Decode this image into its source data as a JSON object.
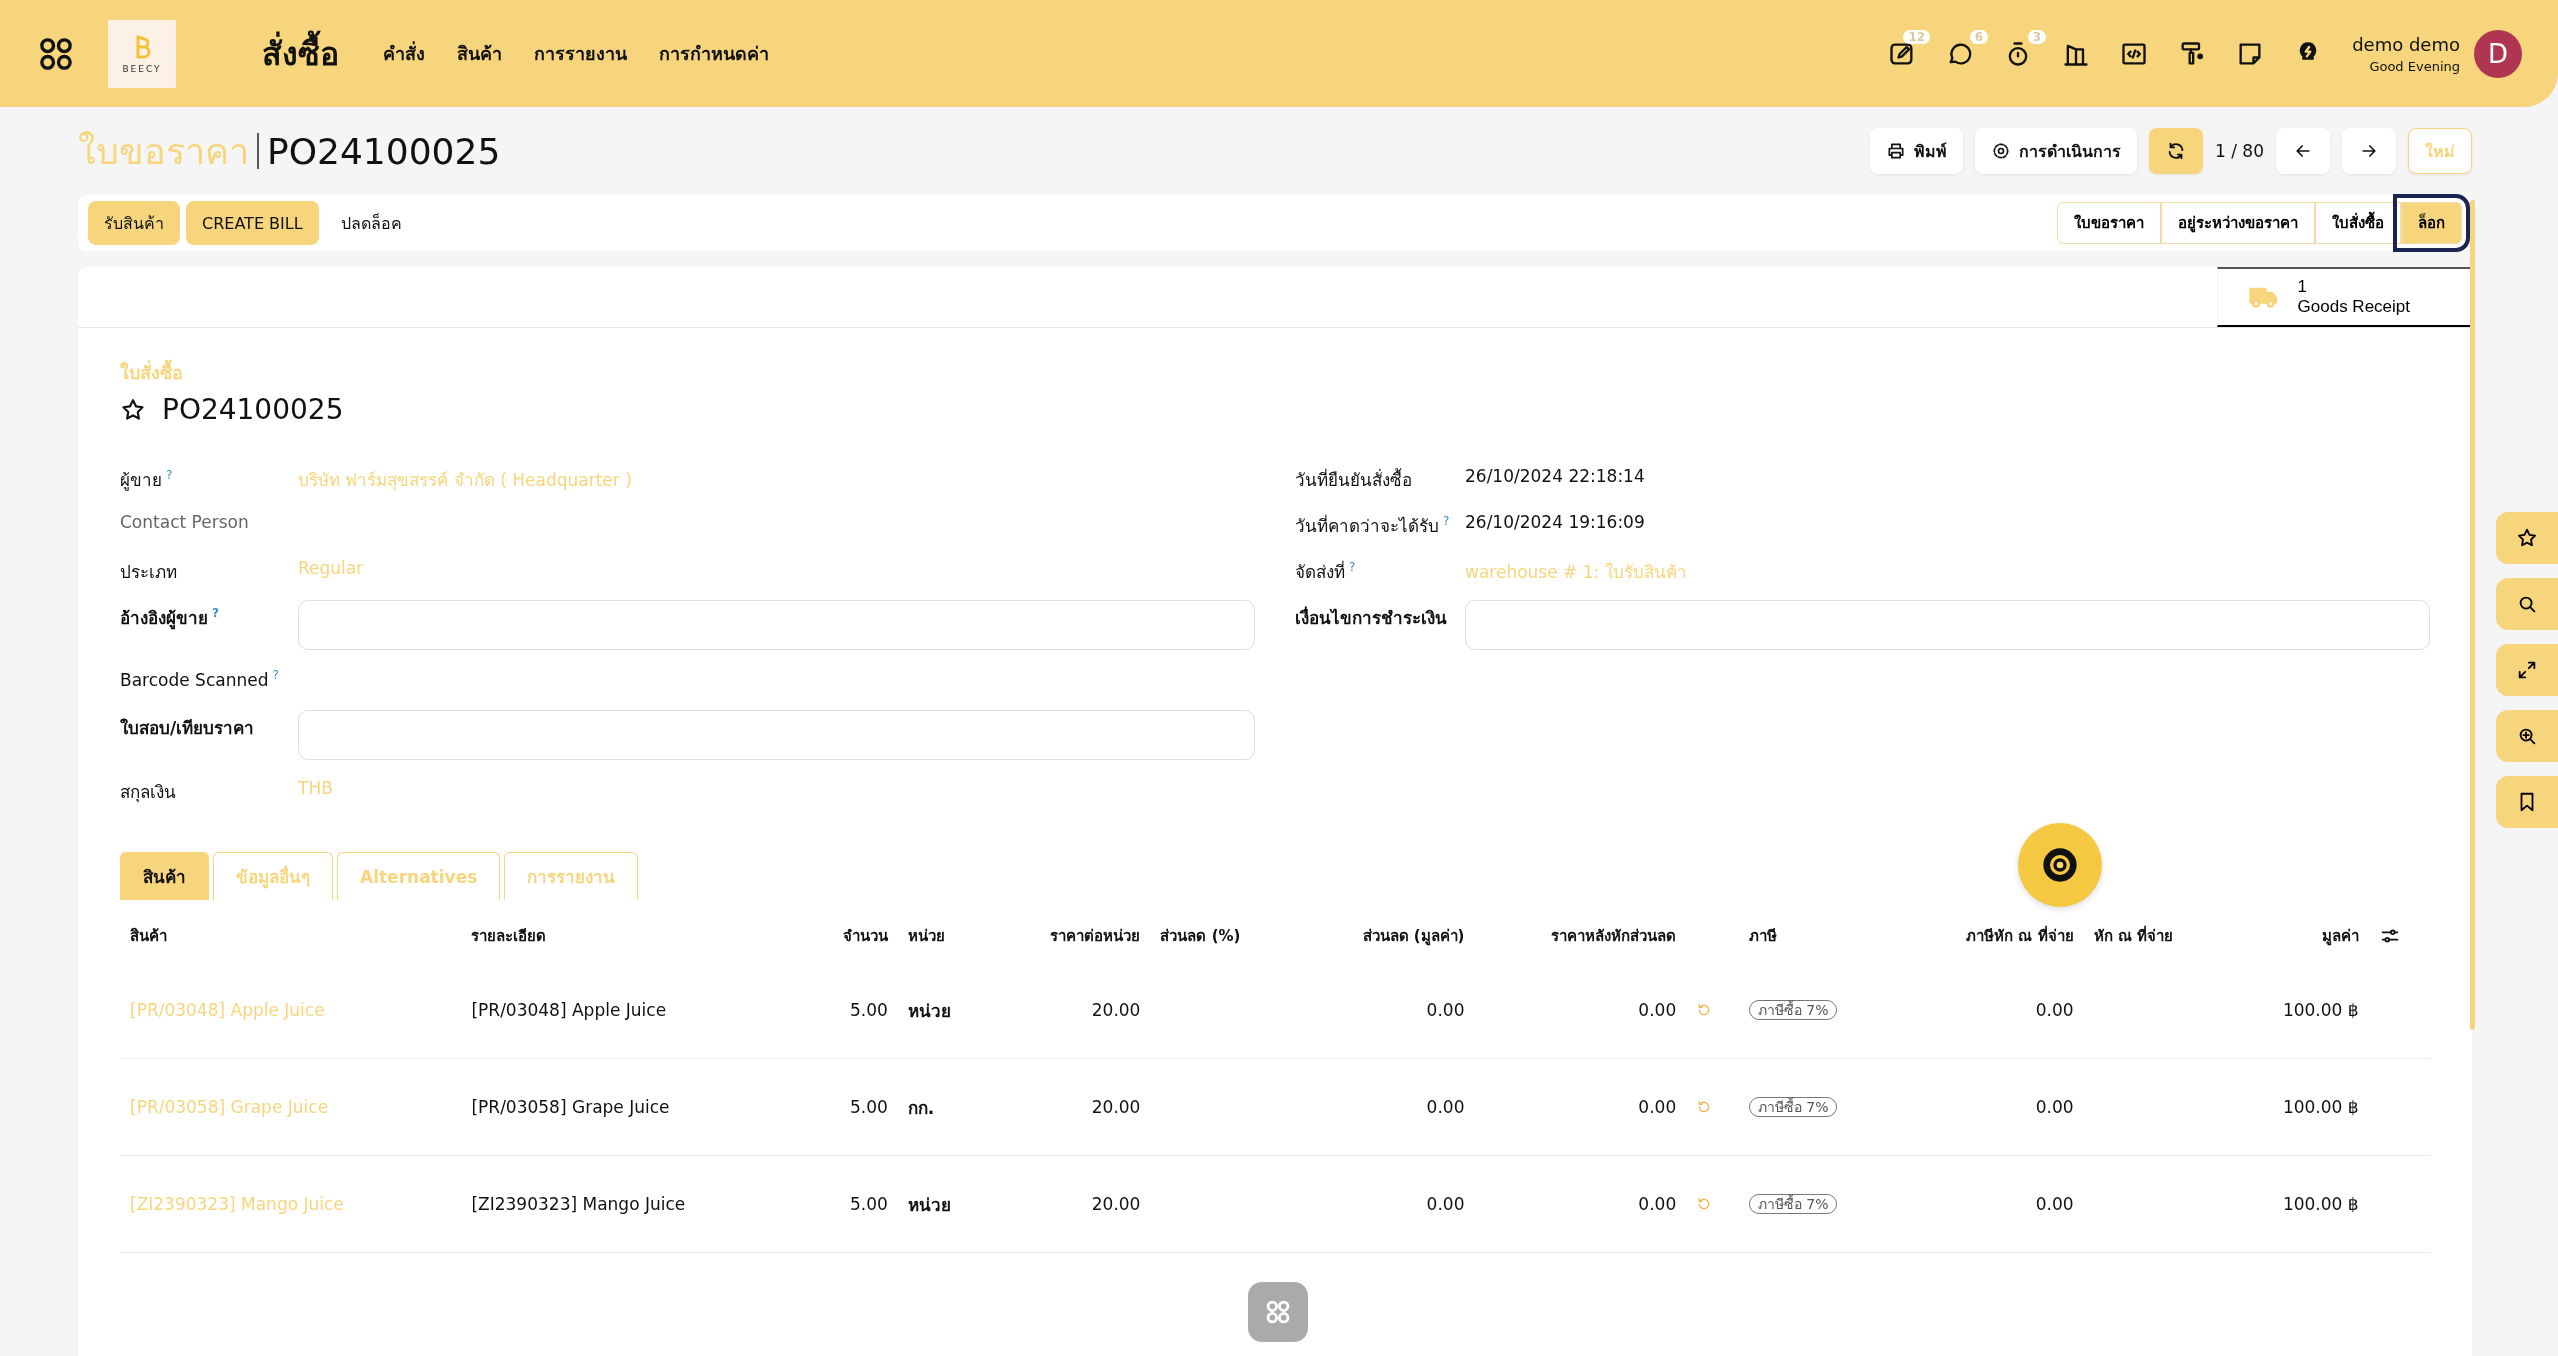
{
  "header": {
    "app_title": "สั่งซื้อ",
    "logo_text": "BEECY",
    "menu": [
      "คำสั่ง",
      "สินค้า",
      "การรายงาน",
      "การกำหนดค่า"
    ],
    "systray": [
      {
        "kind": "note",
        "badge": "12"
      },
      {
        "kind": "chat",
        "badge": "6"
      },
      {
        "kind": "timer",
        "badge": "3"
      },
      {
        "kind": "building"
      },
      {
        "kind": "code"
      },
      {
        "kind": "paint"
      },
      {
        "kind": "sticky"
      },
      {
        "kind": "bulb"
      }
    ],
    "user": {
      "name": "demo demo",
      "greeting": "Good Evening",
      "initial": "D"
    }
  },
  "breadcrumb": {
    "parent": "ใบขอราคา",
    "current": "PO24100025"
  },
  "control_panel": {
    "print": "พิมพ์",
    "actions": "การดำเนินการ",
    "pager": "1 / 80",
    "new": "ใหม่"
  },
  "action_buttons": [
    "รับสินค้า",
    "CREATE BILL"
  ],
  "unlock": "ปลดล็อค",
  "statuses": [
    {
      "label": "ใบขอราคา",
      "selected": false
    },
    {
      "label": "อยู่ระหว่างขอราคา",
      "selected": false
    },
    {
      "label": "ใบสั่งซื้อ",
      "selected": false
    },
    {
      "label": "ล็อก",
      "selected": true
    }
  ],
  "smart_button": {
    "count": "1",
    "label": "Goods Receipt"
  },
  "form": {
    "doc_type": "ใบสั่งซื้อ",
    "name": "PO24100025",
    "left_fields": [
      {
        "label": "ผู้ขาย",
        "help": "?",
        "kind": "link",
        "value": "บริษัท ฟาร์มสุขสรรค์ จำกัด ( Headquarter )"
      },
      {
        "label": "Contact Person",
        "kind": "muted"
      },
      {
        "label": "ประเภท",
        "kind": "link",
        "value": "Regular"
      },
      {
        "label": "อ้างอิงผู้ขาย",
        "help": "?",
        "kind": "input"
      },
      {
        "label": "Barcode Scanned",
        "help": "?",
        "kind": "plain"
      },
      {
        "label": "ใบสอบ/เทียบราคา",
        "kind": "input"
      },
      {
        "label": "สกุลเงิน",
        "kind": "link",
        "value": "THB"
      }
    ],
    "right_fields": [
      {
        "label": "วันที่ยืนยันสั่งซื้อ",
        "kind": "text",
        "value": "26/10/2024 22:18:14"
      },
      {
        "label": "วันที่คาดว่าจะได้รับ",
        "help": "?",
        "kind": "text",
        "value": "26/10/2024 19:16:09"
      },
      {
        "label": "จัดส่งที่",
        "help": "?",
        "kind": "link",
        "value": "warehouse # 1: ใบรับสินค้า"
      },
      {
        "label": "เงื่อนไขการชำระเงิน",
        "kind": "input"
      }
    ]
  },
  "tabs": [
    {
      "label": "สินค้า",
      "selected": true
    },
    {
      "label": "ข้อมูลอื่นๆ",
      "selected": false
    },
    {
      "label": "Alternatives",
      "selected": false
    },
    {
      "label": "การรายงาน",
      "selected": false
    }
  ],
  "table": {
    "columns": [
      "สินค้า",
      "รายละเอียด",
      "จำนวน",
      "หน่วย",
      "ราคาต่อหน่วย",
      "ส่วนลด (%)",
      "ส่วนลด (มูลค่า)",
      "ราคาหลังหักส่วนลด",
      "ภาษี",
      "ภาษีหัก ณ ที่จ่าย",
      "หัก ณ ที่จ่าย",
      "มูลค่า"
    ],
    "rows": [
      {
        "product": "[PR/03048] Apple Juice",
        "description": "[PR/03048] Apple Juice",
        "quantity": "5.00",
        "unit": "หน่วย",
        "unit_price": "20.00",
        "discount_amount": "0.00",
        "net_price": "0.00",
        "tax": "ภาษีซื้อ 7%",
        "withholding": "0.00",
        "subtotal": "100.00 ฿"
      },
      {
        "product": "[PR/03058] Grape Juice",
        "description": "[PR/03058] Grape Juice",
        "quantity": "5.00",
        "unit": "กก.",
        "unit_price": "20.00",
        "discount_amount": "0.00",
        "net_price": "0.00",
        "tax": "ภาษีซื้อ 7%",
        "withholding": "0.00",
        "subtotal": "100.00 ฿"
      },
      {
        "product": "[ZI2390323] Mango Juice",
        "description": "[ZI2390323] Mango Juice",
        "quantity": "5.00",
        "unit": "หน่วย",
        "unit_price": "20.00",
        "discount_amount": "0.00",
        "net_price": "0.00",
        "tax": "ภาษีซื้อ 7%",
        "withholding": "0.00",
        "subtotal": "100.00 ฿"
      }
    ]
  },
  "side_tools": [
    {
      "kind": "star"
    },
    {
      "kind": "search"
    },
    {
      "kind": "expand"
    },
    {
      "kind": "zoom"
    },
    {
      "kind": "bookmark"
    }
  ]
}
